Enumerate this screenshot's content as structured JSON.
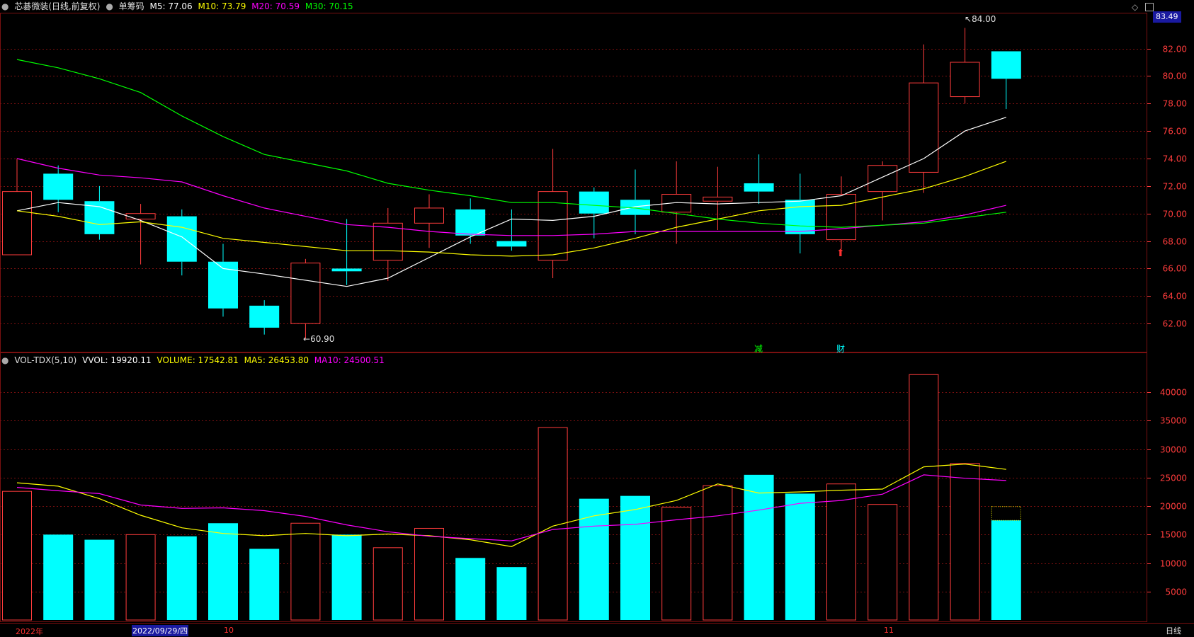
{
  "header": {
    "title": "芯碁微装(日线,前复权)",
    "chip": "单筹码",
    "ma_labels": [
      {
        "text": "M5: 77.06",
        "color": "#ffffff"
      },
      {
        "text": "M10: 73.79",
        "color": "#ffff00"
      },
      {
        "text": "M20: 70.59",
        "color": "#ff00ff"
      },
      {
        "text": "M30: 70.15",
        "color": "#00ff00"
      }
    ],
    "last_price": "83.49"
  },
  "volume_header": {
    "title": "VOL-TDX(5,10)",
    "items": [
      {
        "text": "VVOL: 19920.11",
        "color": "#ffffff"
      },
      {
        "text": "VOLUME: 17542.81",
        "color": "#ffff00"
      },
      {
        "text": "MA5: 26453.80",
        "color": "#ffff00"
      },
      {
        "text": "MA10: 24500.51",
        "color": "#ff00ff"
      }
    ]
  },
  "footer": {
    "labels": [
      "2022年",
      "2022/09/29/四",
      "10",
      "11"
    ],
    "period": "日线"
  },
  "annotations": {
    "high": "84.00",
    "low": "60.90",
    "event1": "减",
    "event2": "财"
  },
  "chart_data": [
    {
      "type": "candlestick",
      "ylim": [
        60,
        84.5
      ],
      "yticks": [
        62,
        64,
        66,
        68,
        70,
        72,
        74,
        76,
        78,
        80,
        82
      ],
      "grid": true,
      "candles": [
        {
          "o": 67.0,
          "c": 71.6,
          "h": 74.0,
          "l": 67.0
        },
        {
          "o": 72.9,
          "c": 71.0,
          "h": 73.5,
          "l": 70.1
        },
        {
          "o": 70.9,
          "c": 68.5,
          "h": 72.0,
          "l": 68.1
        },
        {
          "o": 69.6,
          "c": 70.0,
          "h": 70.7,
          "l": 66.3
        },
        {
          "o": 69.8,
          "c": 66.5,
          "h": 70.3,
          "l": 65.5
        },
        {
          "o": 66.5,
          "c": 63.1,
          "h": 67.8,
          "l": 62.5
        },
        {
          "o": 63.3,
          "c": 61.7,
          "h": 63.7,
          "l": 61.2
        },
        {
          "o": 62.0,
          "c": 66.4,
          "h": 66.7,
          "l": 60.9
        },
        {
          "o": 66.0,
          "c": 65.8,
          "h": 69.6,
          "l": 64.8
        },
        {
          "o": 66.6,
          "c": 69.3,
          "h": 70.4,
          "l": 65.1
        },
        {
          "o": 69.3,
          "c": 70.4,
          "h": 71.4,
          "l": 67.5
        },
        {
          "o": 70.3,
          "c": 68.4,
          "h": 71.1,
          "l": 67.8
        },
        {
          "o": 68.0,
          "c": 67.6,
          "h": 70.3,
          "l": 67.3
        },
        {
          "o": 66.6,
          "c": 71.6,
          "h": 74.7,
          "l": 65.3
        },
        {
          "o": 71.6,
          "c": 70.0,
          "h": 71.9,
          "l": 68.2
        },
        {
          "o": 71.0,
          "c": 69.9,
          "h": 73.2,
          "l": 68.5
        },
        {
          "o": 70.1,
          "c": 71.4,
          "h": 73.8,
          "l": 67.8
        },
        {
          "o": 70.9,
          "c": 71.2,
          "h": 73.4,
          "l": 68.8
        },
        {
          "o": 72.2,
          "c": 71.6,
          "h": 74.3,
          "l": 70.7
        },
        {
          "o": 71.0,
          "c": 68.5,
          "h": 72.9,
          "l": 67.1
        },
        {
          "o": 68.1,
          "c": 71.4,
          "h": 72.7,
          "l": 67.4
        },
        {
          "o": 71.6,
          "c": 73.5,
          "h": 73.8,
          "l": 69.5
        },
        {
          "o": 73.0,
          "c": 79.5,
          "h": 82.3,
          "l": 71.5
        },
        {
          "o": 78.5,
          "c": 81.0,
          "h": 83.5,
          "l": 78.0
        },
        {
          "o": 81.8,
          "c": 79.8,
          "h": 81.8,
          "l": 77.6
        }
      ],
      "series": [
        {
          "name": "M5",
          "color": "#ffffff",
          "values": [
            70.2,
            70.8,
            70.5,
            69.5,
            68.3,
            66.0,
            65.6,
            64.7,
            65.3,
            66.8,
            68.3,
            69.6,
            69.5,
            69.8,
            70.5,
            70.8,
            70.7,
            70.8,
            70.9,
            71.3,
            74.0,
            76.0,
            77.0
          ]
        },
        {
          "name": "M10",
          "color": "#ffff00",
          "values": [
            70.2,
            69.8,
            69.2,
            69.4,
            69.0,
            68.2,
            67.9,
            67.3,
            67.3,
            67.2,
            67.0,
            66.9,
            67.0,
            67.5,
            68.2,
            69.0,
            69.6,
            70.2,
            70.5,
            70.6,
            71.8,
            72.7,
            73.8
          ]
        },
        {
          "name": "M20",
          "color": "#ff00ff",
          "values": [
            74.0,
            73.3,
            72.8,
            72.6,
            72.3,
            71.3,
            70.4,
            69.2,
            69.0,
            68.7,
            68.5,
            68.4,
            68.4,
            68.5,
            68.7,
            68.7,
            68.7,
            68.7,
            68.7,
            68.9,
            69.4,
            69.9,
            70.6
          ]
        },
        {
          "name": "M30",
          "color": "#00ff00",
          "values": [
            81.2,
            80.6,
            79.8,
            78.8,
            77.1,
            75.6,
            74.3,
            73.1,
            72.2,
            71.7,
            71.3,
            70.8,
            70.8,
            70.6,
            70.4,
            70.0,
            69.6,
            69.3,
            69.1,
            69.0,
            69.3,
            69.7,
            70.1
          ]
        }
      ],
      "ma_x_start": [
        0,
        1,
        2,
        3,
        4,
        5,
        6,
        8,
        9,
        10,
        11,
        12,
        13,
        14,
        15,
        16,
        17,
        18,
        19,
        20,
        22,
        23,
        24
      ]
    },
    {
      "type": "bar",
      "ylim": [
        0,
        44500
      ],
      "yticks": [
        5000,
        10000,
        15000,
        20000,
        25000,
        30000,
        35000,
        40000
      ],
      "grid": true,
      "values": [
        22600,
        15000,
        14100,
        15000,
        14700,
        17000,
        12500,
        17000,
        15000,
        12700,
        16100,
        10900,
        9300,
        33800,
        21300,
        21800,
        19800,
        23600,
        25500,
        22200,
        23900,
        20300,
        43100,
        27500,
        17500
      ],
      "vvol_last": 19920,
      "series": [
        {
          "name": "MA5",
          "color": "#ffff00",
          "values": [
            24100,
            23500,
            21300,
            18400,
            16200,
            15200,
            14800,
            15200,
            14800,
            15100,
            14800,
            14100,
            12900,
            16500,
            18300,
            19400,
            21000,
            23900,
            22300,
            22500,
            22800,
            23000,
            26900,
            27400,
            26450
          ]
        },
        {
          "name": "MA10",
          "color": "#ff00ff",
          "values": [
            23300,
            22700,
            22200,
            20200,
            19600,
            19700,
            19200,
            18200,
            16700,
            15500,
            14700,
            14300,
            13900,
            15900,
            16500,
            16800,
            17600,
            18300,
            19300,
            20500,
            21000,
            22100,
            25500,
            24900,
            24500
          ]
        }
      ]
    }
  ]
}
